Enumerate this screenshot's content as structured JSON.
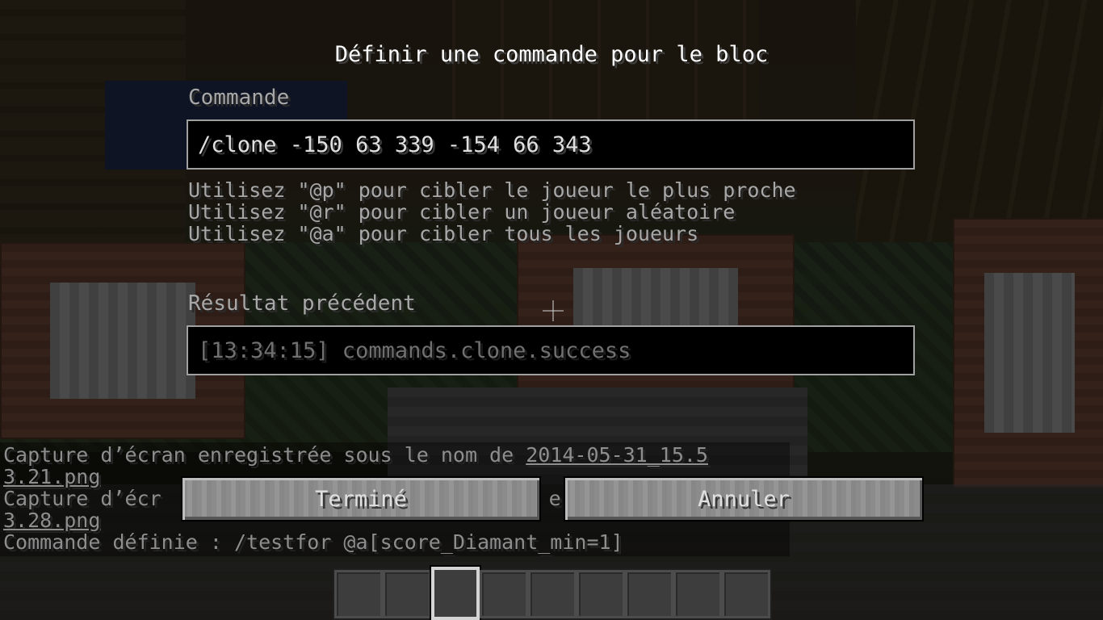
{
  "screen": {
    "title": "Définir une commande pour le bloc"
  },
  "command": {
    "label": "Commande",
    "value": "/clone -150 63 339 -154 66 343"
  },
  "hints": [
    "Utilisez \"@p\" pour cibler le joueur le plus proche",
    "Utilisez \"@r\" pour cibler un joueur aléatoire",
    "Utilisez \"@a\" pour cibler tous les joueurs"
  ],
  "result": {
    "label": "Résultat précédent",
    "value": "[13:34:15] commands.clone.success"
  },
  "chat": {
    "line1_prefix": "Capture d’écran enregistrée sous le nom de ",
    "line1_link": "2014-05-31_15.5",
    "line2_link": "3.21.png",
    "line3_prefix": "Capture d’écr",
    "line3_suffix": "e ",
    "line4_link": "3.28.png",
    "line5": "Commande définie : /testfor @a[score_Diamant_min=1]"
  },
  "buttons": {
    "done": "Terminé",
    "cancel": "Annuler"
  },
  "hotbar": {
    "slot_count": 9,
    "selected_index": 2
  }
}
